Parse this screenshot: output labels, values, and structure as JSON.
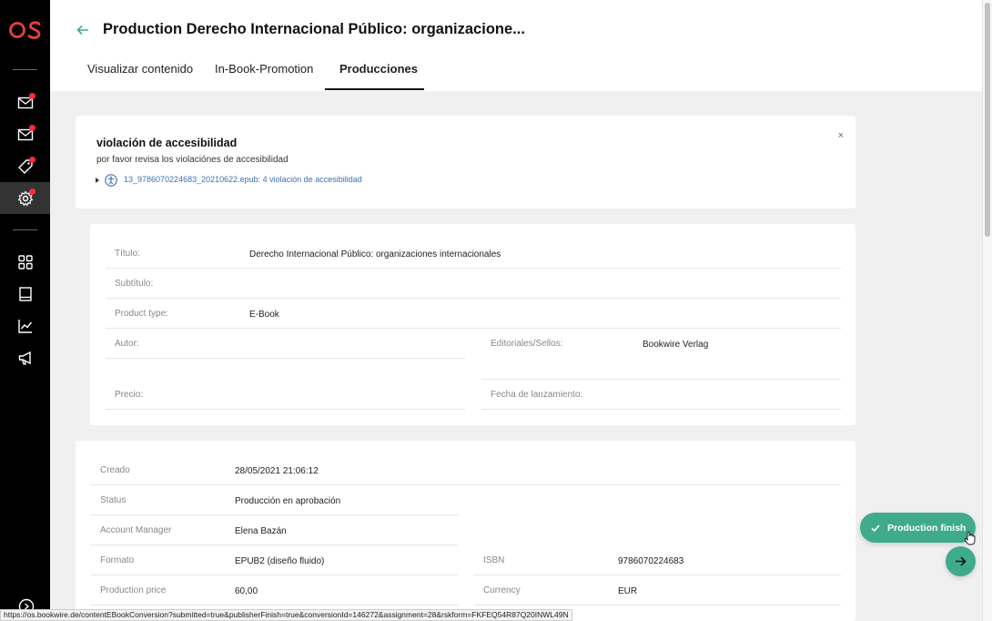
{
  "app": {
    "logo_text": "OS",
    "brand_color": "#e8413c",
    "accent_color": "#3fab8a"
  },
  "sidebar": {
    "items": [
      {
        "icon": "mail-icon",
        "badge": true
      },
      {
        "icon": "mail-icon",
        "badge": true
      },
      {
        "icon": "tag-icon",
        "badge": true
      },
      {
        "icon": "gear-icon",
        "badge": true,
        "active": true
      },
      {
        "icon": "grid-icon",
        "badge": false
      },
      {
        "icon": "book-icon",
        "badge": false
      },
      {
        "icon": "chart-icon",
        "badge": false
      },
      {
        "icon": "megaphone-icon",
        "badge": false
      }
    ]
  },
  "header": {
    "title": "Production Derecho Internacional Público: organizacione...",
    "tabs": [
      {
        "label": "Visualizar contenido",
        "active": false
      },
      {
        "label": "In-Book-Promotion",
        "active": false
      },
      {
        "label": "Producciones",
        "active": true
      }
    ]
  },
  "alert": {
    "title": "violación de accesibilidad",
    "subtitle": "por favor revisa los violaciónes de accesibilidad",
    "link": "13_9786070224683_20210622.epub: 4 violación de accesibilidad",
    "close": "×"
  },
  "product": {
    "titulo_label": "Título:",
    "titulo_value": "Derecho Internacional Público: organizaciones internacionales",
    "subtitulo_label": "Subtítulo:",
    "subtitulo_value": "",
    "product_type_label": "Product type:",
    "product_type_value": "E-Book",
    "autor_label": "Autor:",
    "autor_value": "",
    "editoriales_label": "Editoriales/Sellos:",
    "editoriales_value": "Bookwire Verlag",
    "precio_label": "Precio:",
    "precio_value": "",
    "fecha_label": "Fecha de lanzamiento:",
    "fecha_value": ""
  },
  "production": {
    "creado_label": "Creado",
    "creado_value": "28/05/2021 21:06:12",
    "status_label": "Status",
    "status_value": "Producción en aprobación",
    "manager_label": "Account Manager",
    "manager_value": "Elena Bazán",
    "formato_label": "Formato",
    "formato_value": "EPUB2 (diseño fluido)",
    "isbn_label": "ISBN",
    "isbn_value": "9786070224683",
    "price_label": "Production price",
    "price_value": "60,00",
    "currency_label": "Currency",
    "currency_value": "EUR"
  },
  "actions": {
    "finish_label": "Production finish"
  },
  "status_bar": {
    "url": "https://os.bookwire.de/contentEBookConversion?submitted=true&publisherFinish=true&conversionId=146272&assignment=28&rskform=FKFEQ54R87Q20INWL49N"
  }
}
